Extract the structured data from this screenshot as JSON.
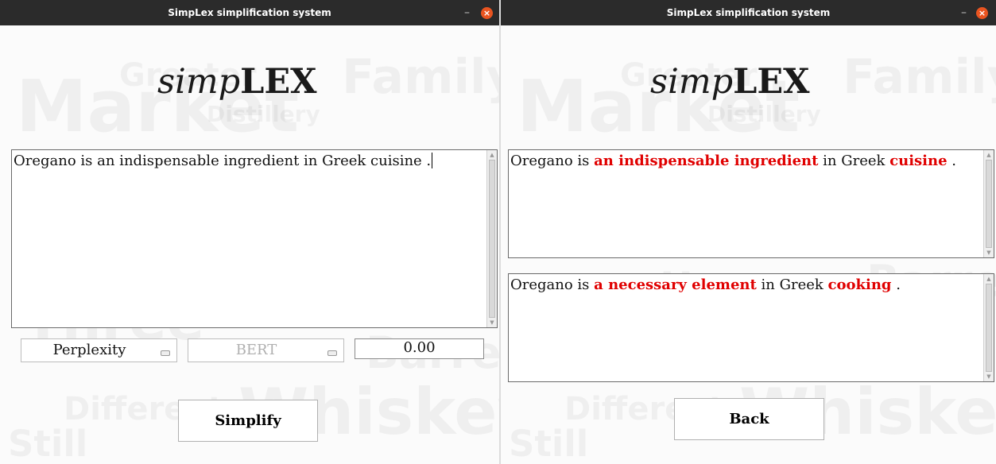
{
  "left_window": {
    "title": "SimpLex simplification system",
    "logo": {
      "italic": "simp",
      "bold": "LEX"
    },
    "input_text": "Oregano is an indispensable ingredient in Greek cuisine .",
    "metric_select": "Perplexity",
    "model_select": "BERT",
    "score_value": "0.00",
    "simplify_label": "Simplify"
  },
  "right_window": {
    "title": "SimpLex simplification system",
    "logo": {
      "italic": "simp",
      "bold": "LEX"
    },
    "original": [
      {
        "text": "Oregano is ",
        "hl": false
      },
      {
        "text": "an indispensable ingredient",
        "hl": true
      },
      {
        "text": " in Greek ",
        "hl": false
      },
      {
        "text": "cuisine",
        "hl": true
      },
      {
        "text": " .",
        "hl": false
      }
    ],
    "simplified": [
      {
        "text": "Oregano is ",
        "hl": false
      },
      {
        "text": "a necessary element",
        "hl": true
      },
      {
        "text": " in Greek ",
        "hl": false
      },
      {
        "text": "cooking",
        "hl": true
      },
      {
        "text": " .",
        "hl": false
      }
    ],
    "back_label": "Back"
  },
  "window_controls": {
    "minimize": "–",
    "close": "×"
  },
  "colors": {
    "titlebar": "#2b2b2b",
    "close_button": "#e95420",
    "highlight": "#e00000"
  }
}
